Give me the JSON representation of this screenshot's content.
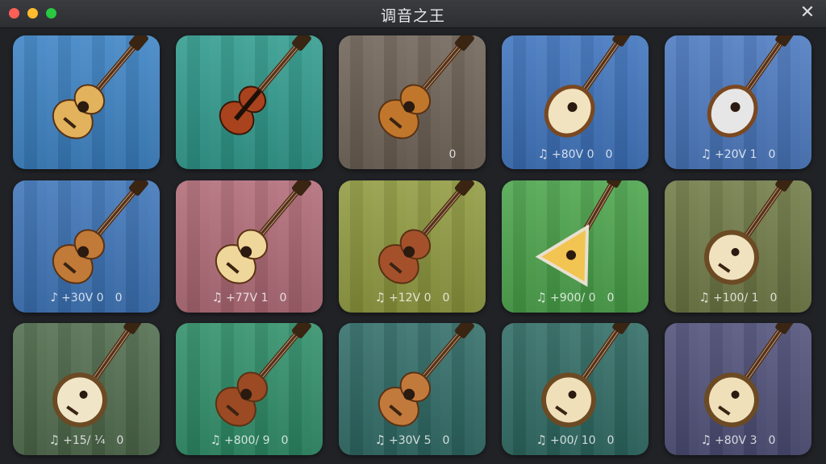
{
  "window": {
    "title": "调音之王",
    "close_glyph": "✕"
  },
  "tiles": [
    {
      "instrument": "acoustic-guitar",
      "color": "#3b82c4",
      "note": "",
      "value": "",
      "count": ""
    },
    {
      "instrument": "violin",
      "color": "#2f9a8c",
      "note": "",
      "value": "",
      "count": ""
    },
    {
      "instrument": "cello",
      "color": "#6e6256",
      "note": "",
      "value": "",
      "count": "0"
    },
    {
      "instrument": "oud",
      "color": "#3d73bd",
      "note": "♫",
      "value": "+80V 0",
      "count": "0"
    },
    {
      "instrument": "lute",
      "color": "#4a78bf",
      "note": "♫",
      "value": "+20V 1",
      "count": "0"
    },
    {
      "instrument": "dreadnought-guitar",
      "color": "#3c74b8",
      "note": "♪",
      "value": "+30V 0",
      "count": "0"
    },
    {
      "instrument": "ukulele-white",
      "color": "#b06a76",
      "note": "♫",
      "value": "+77V 1",
      "count": "0"
    },
    {
      "instrument": "ukulele-red",
      "color": "#8f9a3e",
      "note": "♫",
      "value": "+12V 0",
      "count": "0"
    },
    {
      "instrument": "balalaika",
      "color": "#4aa34a",
      "note": "♫",
      "value": "+900/ 0",
      "count": "0"
    },
    {
      "instrument": "mandolin-round",
      "color": "#6f7a45",
      "note": "♫",
      "value": "+100/ 1",
      "count": "0"
    },
    {
      "instrument": "mandolin-bowl",
      "color": "#4f6b4c",
      "note": "♫",
      "value": "+15/ ¼",
      "count": "0"
    },
    {
      "instrument": "soprano-ukulele",
      "color": "#2e8e68",
      "note": "♫",
      "value": "+800/ 9",
      "count": "0"
    },
    {
      "instrument": "concert-ukulele",
      "color": "#2f6b66",
      "note": "♫",
      "value": "+30V 5",
      "count": "0"
    },
    {
      "instrument": "bouzouki",
      "color": "#2e6a63",
      "note": "♫",
      "value": "+00/ 10",
      "count": "0"
    },
    {
      "instrument": "saz",
      "color": "#4e4f78",
      "note": "♫",
      "value": "+80V 3",
      "count": "0"
    }
  ]
}
